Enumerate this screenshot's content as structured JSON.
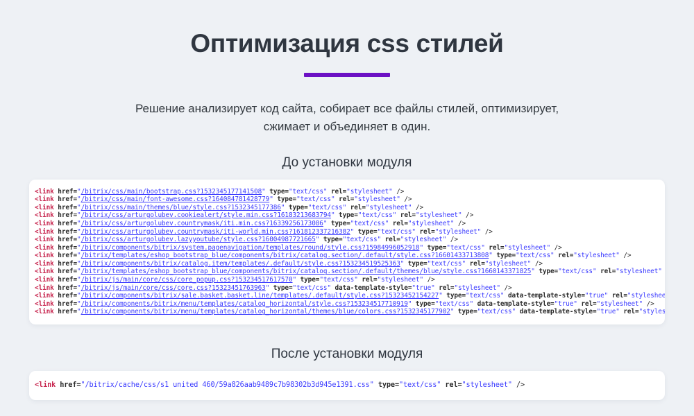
{
  "theme": {
    "background": "#eef1f5",
    "accent": "#6c10c4",
    "panel_background": "#ffffff",
    "title_color": "#2f3640",
    "code_tag_color": "#c7254e",
    "code_string_color": "#3a3aff"
  },
  "header": {
    "title": "Оптимизация css стилей"
  },
  "intro": {
    "line1": "Решение анализирует код сайта, собирает все файлы стилей, оптимизирует,",
    "line2": "сжимает и объединяет в один."
  },
  "sections": {
    "before_label": "До установки модуля",
    "after_label": "После установки модуля"
  },
  "code": {
    "tag_open": "<link",
    "attr_href": "href=",
    "attr_type": "type=",
    "attr_rel": "rel=",
    "attr_data_template_style": "data-template-style=",
    "value_type": "\"text/css\"",
    "value_rel": "\"stylesheet\"",
    "value_true": "\"true\"",
    "tag_close": "/>",
    "quote": "\"",
    "before_lines": [
      {
        "href": "/bitrix/css/main/bootstrap.css?1532345177141508",
        "type": "\"text/css\"",
        "rel": "\"stylesheet\"",
        "data_template_style": null
      },
      {
        "href": "/bitrix/css/main/font-awesome.css?164084781428779",
        "type": "\"text/css\"",
        "rel": "\"stylesheet\"",
        "data_template_style": null
      },
      {
        "href": "/bitrix/css/main/themes/blue/style.css?1532345177386",
        "type": "\"text/css\"",
        "rel": "\"stylesheet\"",
        "data_template_style": null
      },
      {
        "href": "/bitrix/css/arturgolubev.cookiealert/style.min.css?16183213683794",
        "type": "\"text/css\"",
        "rel": "\"stylesheet\"",
        "data_template_style": null
      },
      {
        "href": "/bitrix/css/arturgolubev.countrymask/iti.min.css?16339256173086",
        "type": "\"text/css\"",
        "rel": "\"stylesheet\"",
        "data_template_style": null
      },
      {
        "href": "/bitrix/css/arturgolubev.countrymask/iti-world.min.css?161812337216382",
        "type": "\"text/css\"",
        "rel": "\"stylesheet\"",
        "data_template_style": null
      },
      {
        "href": "/bitrix/css/arturgolubev.lazyyoutube/style.css?16004987721665",
        "type": "\"text/css\"",
        "rel": "\"stylesheet\"",
        "data_template_style": null
      },
      {
        "href": "/bitrix/components/bitrix/system.pagenavigation/templates/round/style.css?15984996052918",
        "type": "\"text/css\"",
        "rel": "\"stylesheet\"",
        "data_template_style": null
      },
      {
        "href": "/bitrix/templates/eshop_bootstrap_blue/components/bitrix/catalog.section/.default/style.css?16601433713808",
        "type": "\"text/css\"",
        "rel": "\"stylesheet\"",
        "data_template_style": null
      },
      {
        "href": "/bitrix/components/bitrix/catalog.item/templates/.default/style.css?153234519525363",
        "type": "\"text/css\"",
        "rel": "\"stylesheet\"",
        "data_template_style": null
      },
      {
        "href": "/bitrix/templates/eshop_bootstrap_blue/components/bitrix/catalog.section/.default/themes/blue/style.css?1660143371825",
        "type": "\"text/css\"",
        "rel": "\"stylesheet\"",
        "data_template_style": null
      },
      {
        "href": "/bitrix/js/main/core/css/core_popup.css?153234517617570",
        "type": "\"text/css\"",
        "rel": "\"stylesheet\"",
        "data_template_style": null
      },
      {
        "href": "/bitrix/js/main/core/css/core.css?15323451763963",
        "type": "\"text/css\"",
        "rel": "\"stylesheet\"",
        "data_template_style": "\"true\""
      },
      {
        "href": "/bitrix/components/bitrix/sale.basket.basket.line/templates/.default/style.css?15323452154227",
        "type": "\"text/css\"",
        "rel": "\"stylesheet\"",
        "data_template_style": "\"true\""
      },
      {
        "href": "/bitrix/components/bitrix/menu/templates/catalog_horizontal/style.css?153234517710919",
        "type": "\"text/css\"",
        "rel": "\"stylesheet\"",
        "data_template_style": "\"true\""
      },
      {
        "href": "/bitrix/components/bitrix/menu/templates/catalog_horizontal/themes/blue/colors.css?1532345177902",
        "type": "\"text/css\"",
        "rel": "\"stylesheet\"",
        "data_template_style": "\"true\""
      }
    ],
    "after_lines": [
      {
        "href": "/bitrix/cache/css/s1 united 460/59a826aab9489c7b98302b3d945e1391.css",
        "type": "\"text/css\"",
        "rel": "\"stylesheet\"",
        "data_template_style": null
      }
    ]
  }
}
